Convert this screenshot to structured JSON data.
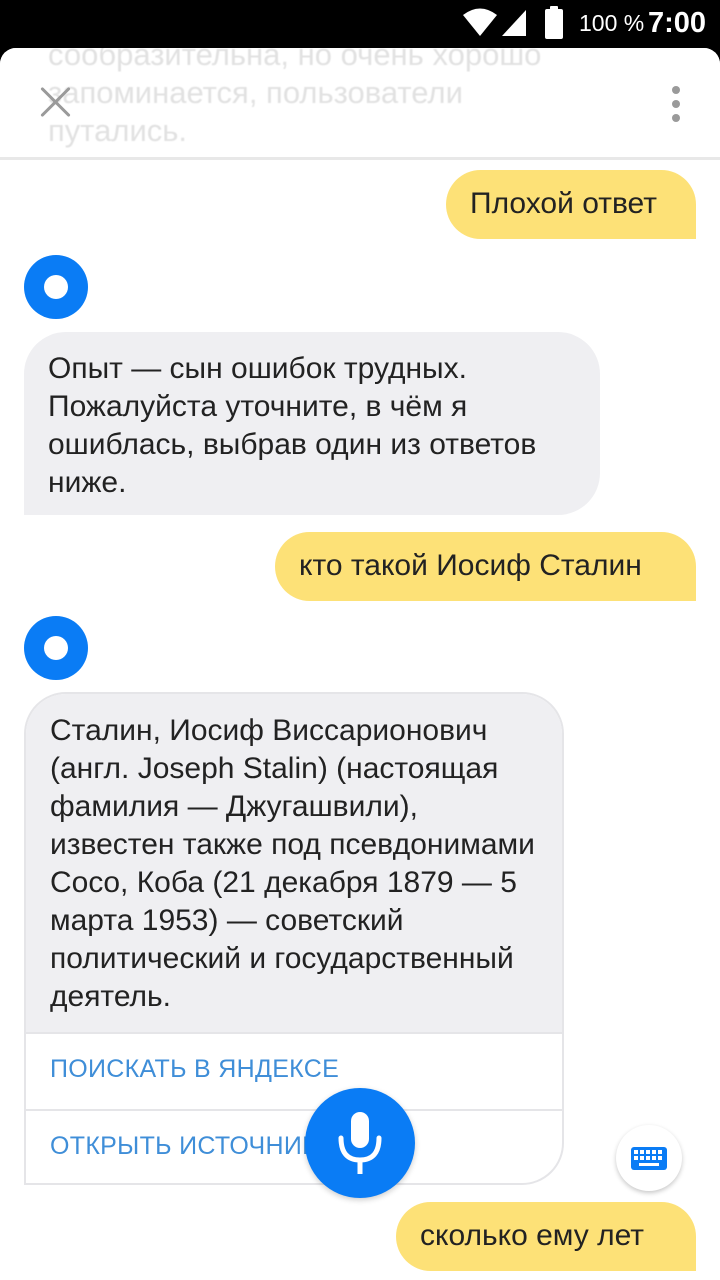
{
  "status_bar": {
    "battery_percent": "100 %",
    "time": "7:00"
  },
  "header": {
    "faded_text": "сообразительна, но очень хорошо\nзапоминается, пользователи\nпутались."
  },
  "messages": {
    "user1": "Плохой ответ",
    "bot1": "Опыт — сын ошибок трудных. Пожалуйста уточните, в чём я ошиблась, выбрав один из ответов ниже.",
    "user2": "кто такой Иосиф Сталин",
    "bot2": "Сталин, Иосиф Виссарионович (англ. Joseph Stalin) (настоящая фамилия — Джугашвили), известен также под псевдонимами Coco, Коба (21 декабря 1879 — 5 марта 1953) — советский политический и государственный деятель.",
    "user3": "сколько ему лет"
  },
  "card_actions": {
    "search": "ПОИСКАТЬ В ЯНДЕКСЕ",
    "open_source": "ОТКРЫТЬ ИСТОЧНИК"
  },
  "icons": {
    "close": "close-icon",
    "menu": "more-vert-icon",
    "mic": "microphone-icon",
    "keyboard": "keyboard-icon",
    "avatar": "alice-avatar-icon"
  },
  "colors": {
    "accent": "#0a7cf5",
    "user_bubble": "#fde177",
    "bot_bubble": "#efeff2",
    "link": "#3f8ed8"
  }
}
